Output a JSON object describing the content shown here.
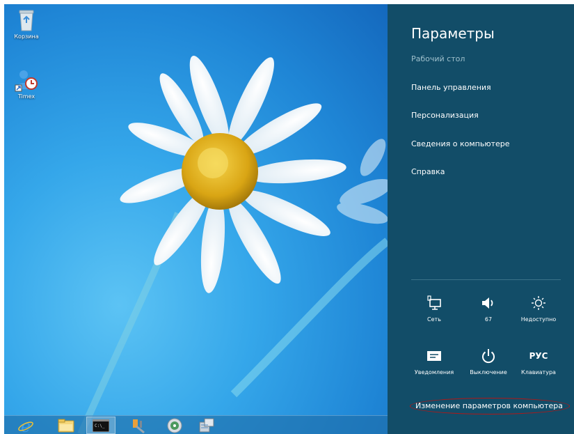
{
  "desktop": {
    "icons": [
      {
        "label": "Корзина",
        "icon": "recycle-bin-icon"
      },
      {
        "label": "Timex",
        "icon": "timex-shortcut-icon"
      }
    ]
  },
  "taskbar": {
    "buttons": [
      {
        "icon": "internet-explorer-icon"
      },
      {
        "icon": "file-explorer-icon"
      },
      {
        "icon": "command-prompt-icon"
      },
      {
        "icon": "tools-icon"
      },
      {
        "icon": "disc-icon"
      },
      {
        "icon": "network-setup-icon"
      }
    ]
  },
  "charm": {
    "title": "Параметры",
    "context": "Рабочий стол",
    "links": [
      "Панель управления",
      "Персонализация",
      "Сведения о компьютере",
      "Справка"
    ],
    "quick_settings": [
      {
        "label": "Сеть",
        "icon": "network-icon"
      },
      {
        "label": "67",
        "icon": "volume-icon"
      },
      {
        "label": "Недоступно",
        "icon": "brightness-icon"
      },
      {
        "label": "Уведомления",
        "icon": "notifications-icon"
      },
      {
        "label": "Выключение",
        "icon": "power-icon"
      },
      {
        "label": "Клавиатура",
        "icon": "keyboard-language-icon",
        "glyph": "РУС"
      }
    ],
    "pc_settings": "Изменение параметров компьютера"
  },
  "colors": {
    "charm_bg": "#124d68",
    "highlight_ellipse": "#b01818"
  }
}
